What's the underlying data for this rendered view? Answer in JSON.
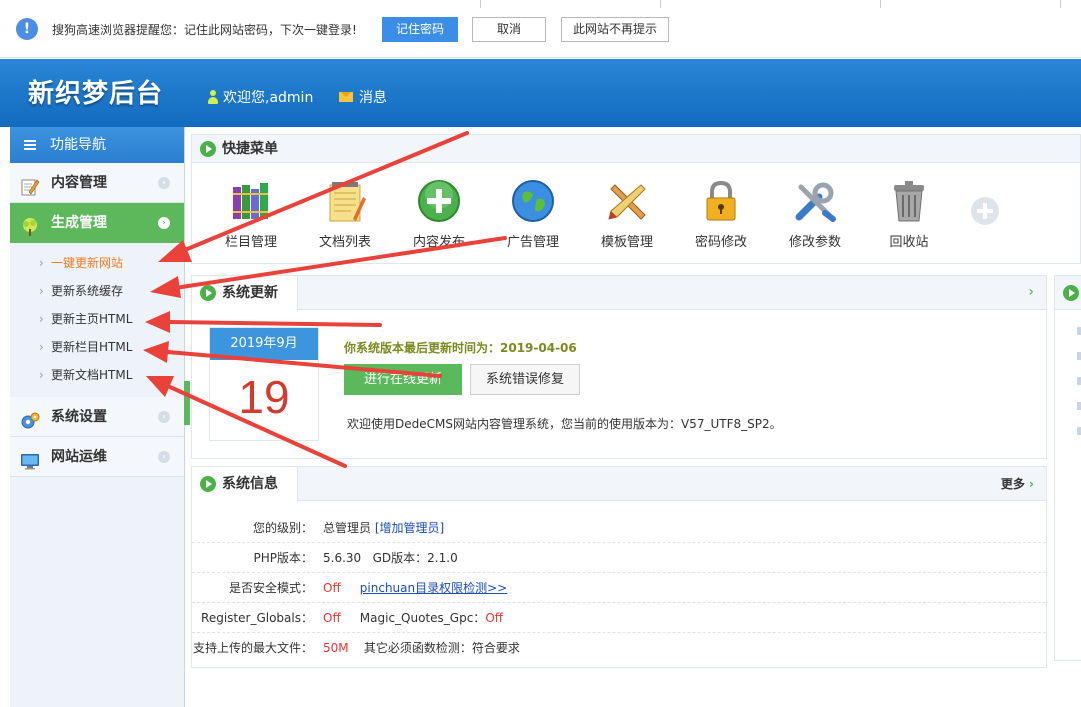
{
  "password_bar": {
    "message": "搜狗高速浏览器提醒您：记住此网站密码，下次一键登录!",
    "remember_label": "记住密码",
    "cancel_label": "取消",
    "never_label": "此网站不再提示"
  },
  "header": {
    "logo": "新织梦后台",
    "welcome": "欢迎您,admin",
    "messages": "消息"
  },
  "sidebar": {
    "title": "功能导航",
    "items": [
      {
        "label": "内容管理"
      },
      {
        "label": "生成管理"
      },
      {
        "label": "系统设置"
      },
      {
        "label": "网站运维"
      }
    ],
    "subitems": [
      {
        "label": "一键更新网站"
      },
      {
        "label": "更新系统缓存"
      },
      {
        "label": "更新主页HTML"
      },
      {
        "label": "更新栏目HTML"
      },
      {
        "label": "更新文档HTML"
      }
    ]
  },
  "quick_menu": {
    "title": "快捷菜单",
    "items": [
      {
        "label": "栏目管理",
        "icon": "books-icon"
      },
      {
        "label": "文档列表",
        "icon": "notepad-icon"
      },
      {
        "label": "内容发布",
        "icon": "plus-circle-icon"
      },
      {
        "label": "广告管理",
        "icon": "globe-icon"
      },
      {
        "label": "模板管理",
        "icon": "ruler-pencil-icon"
      },
      {
        "label": "密码修改",
        "icon": "lock-icon"
      },
      {
        "label": "修改参数",
        "icon": "tools-icon"
      },
      {
        "label": "回收站",
        "icon": "trash-icon"
      }
    ]
  },
  "system_update": {
    "title": "系统更新",
    "calendar_month": "2019年9月",
    "calendar_day": "19",
    "last_update": "你系统版本最后更新时间为：2019-04-06",
    "online_update_label": "进行在线更新",
    "repair_label": "系统错误修复",
    "welcome": "欢迎使用DedeCMS网站内容管理系统，您当前的使用版本为：V57_UTF8_SP2。"
  },
  "system_info": {
    "title": "系统信息",
    "more": "更多",
    "level_key": "您的级别：",
    "level_value": "总管理员",
    "add_admin": "[增加管理员]",
    "php_key": "PHP版本：",
    "php_value": "5.6.30",
    "gd_text": "GD版本：2.1.0",
    "safe_key": "是否安全模式：",
    "safe_value": "Off",
    "perm_link": "pinchuan目录权限检测>>",
    "rg_key": "Register_Globals：",
    "rg_value": "Off",
    "mq_key": "Magic_Quotes_Gpc：",
    "mq_value": "Off",
    "upload_key": "支持上传的最大文件：",
    "upload_value": "50M",
    "func_text": "其它必须函数检测：符合要求"
  },
  "colors": {
    "header_blue": "#1a76c9",
    "accent_green": "#5cb85c",
    "arrow_red": "#e8423a",
    "current_orange": "#f47b20"
  }
}
